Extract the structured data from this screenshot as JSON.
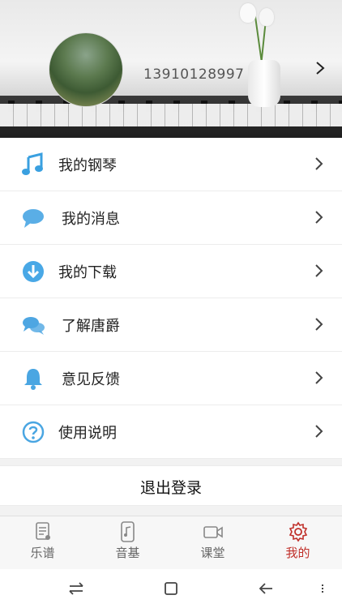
{
  "header": {
    "phone": "13910128997",
    "avatar_icon": "avatar-photo",
    "chevron_icon": "chevron-right-icon"
  },
  "menu": [
    {
      "label": "我的钢琴",
      "icon": "music-note-icon",
      "color": "#3aa0e0"
    },
    {
      "label": "我的消息",
      "icon": "chat-bubble-icon",
      "color": "#5aaee6"
    },
    {
      "label": "我的下载",
      "icon": "download-icon",
      "color": "#49a8e6"
    },
    {
      "label": "了解唐爵",
      "icon": "chat-bubbles-icon",
      "color": "#4ea6e2"
    },
    {
      "label": "意见反馈",
      "icon": "bell-icon",
      "color": "#4aa6e2"
    },
    {
      "label": "使用说明",
      "icon": "help-icon",
      "color": "#4aa6e2"
    }
  ],
  "logout": {
    "label": "退出登录"
  },
  "tabs": [
    {
      "label": "乐谱",
      "icon": "score-icon",
      "active": false
    },
    {
      "label": "音基",
      "icon": "phone-music-icon",
      "active": false
    },
    {
      "label": "课堂",
      "icon": "video-icon",
      "active": false
    },
    {
      "label": "我的",
      "icon": "gear-icon",
      "active": true
    }
  ],
  "system_nav": [
    "swap-icon",
    "home-square-icon",
    "back-icon",
    "more-icon"
  ],
  "colors": {
    "accent": "#c0302a",
    "icon_blue": "#4aa6e2"
  }
}
